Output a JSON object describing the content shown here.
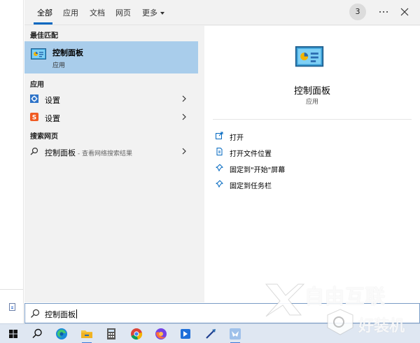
{
  "tabs": [
    {
      "label": "全部",
      "active": true
    },
    {
      "label": "应用"
    },
    {
      "label": "文档"
    },
    {
      "label": "网页"
    },
    {
      "label": "更多"
    }
  ],
  "header": {
    "badge_count": "3",
    "more_icon": "ellipsis-icon",
    "close_icon": "close-icon"
  },
  "results": {
    "best_match_header": "最佳匹配",
    "best_match": {
      "title": "控制面板",
      "subtitle": "应用",
      "icon": "control-panel-icon"
    },
    "apps_header": "应用",
    "apps": [
      {
        "label": "设置",
        "icon": "settings-gear-icon"
      },
      {
        "label": "设置",
        "icon": "sogou-settings-icon"
      }
    ],
    "web_header": "搜索网页",
    "web": {
      "label": "控制面板",
      "hint": " - 查看网络搜索结果",
      "icon": "search-icon"
    }
  },
  "details": {
    "title": "控制面板",
    "subtitle": "应用",
    "actions": [
      {
        "label": "打开",
        "icon": "open-icon"
      },
      {
        "label": "打开文件位置",
        "icon": "file-location-icon"
      },
      {
        "label": "固定到\"开始\"屏幕",
        "icon": "pin-start-icon"
      },
      {
        "label": "固定到任务栏",
        "icon": "pin-taskbar-icon"
      }
    ]
  },
  "search": {
    "value": "控制面板",
    "icon": "search-icon"
  },
  "taskbar": {
    "items": [
      "windows-start-icon",
      "search-icon",
      "edge-icon",
      "file-explorer-icon",
      "calculator-icon",
      "chrome-icon",
      "firefox-icon",
      "app-blue-icon",
      "feather-tool-icon",
      "app-active-icon"
    ]
  },
  "watermark": {
    "text": "自由互联",
    "text2": "好装机"
  },
  "colors": {
    "accent": "#0067c0",
    "selection": "#a9cdeb",
    "panel": "#f2f2f2",
    "taskbar": "#dfe7f2"
  }
}
